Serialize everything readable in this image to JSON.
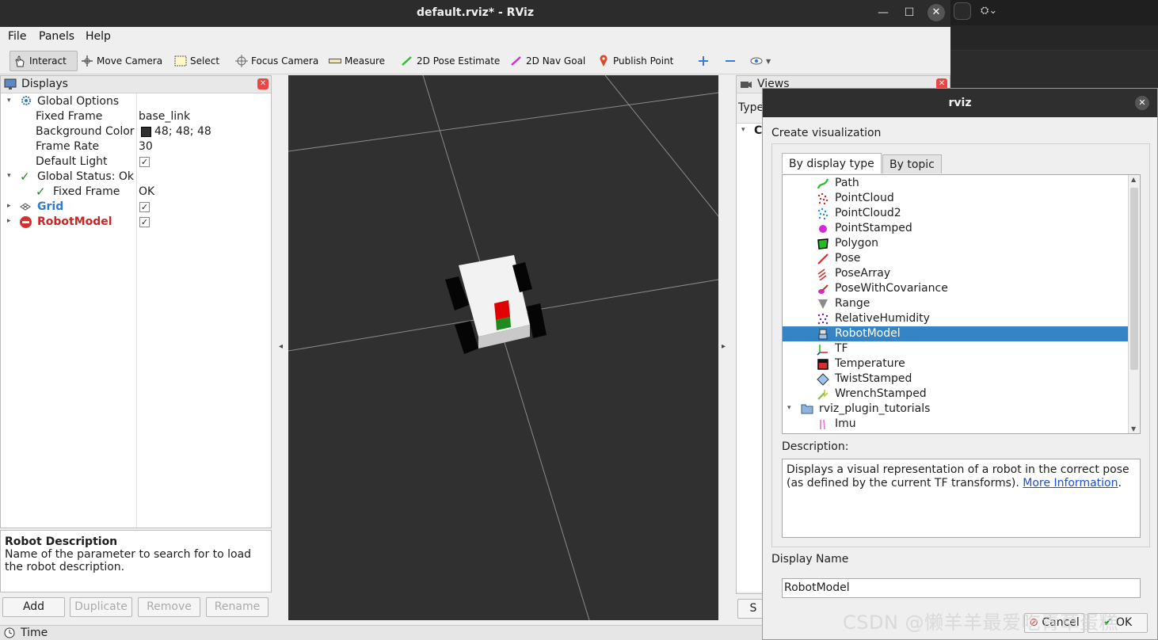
{
  "window": {
    "title": "default.rviz* - RViz",
    "minimize": "—",
    "maximize": "☐",
    "close": "✕"
  },
  "menu": {
    "file": "File",
    "panels": "Panels",
    "help": "Help"
  },
  "toolbar": {
    "interact": "Interact",
    "move_camera": "Move Camera",
    "select": "Select",
    "focus_camera": "Focus Camera",
    "measure": "Measure",
    "pose_estimate": "2D Pose Estimate",
    "nav_goal": "2D Nav Goal",
    "publish_point": "Publish Point"
  },
  "displays": {
    "title": "Displays",
    "rows": [
      {
        "label": "Global Options",
        "value": ""
      },
      {
        "label": "Fixed Frame",
        "value": "base_link"
      },
      {
        "label": "Background Color",
        "value": "48; 48; 48"
      },
      {
        "label": "Frame Rate",
        "value": "30"
      },
      {
        "label": "Default Light",
        "value": "✓"
      },
      {
        "label": "Global Status: Ok",
        "value": ""
      },
      {
        "label": "Fixed Frame",
        "value": "OK"
      },
      {
        "label": "Grid",
        "value": "✓"
      },
      {
        "label": "RobotModel",
        "value": "✓"
      }
    ],
    "colors": {
      "grid": "#2e7bcf",
      "robotmodel": "#c62828",
      "bg_swatch": "#303030"
    }
  },
  "description_panel": {
    "heading": "Robot Description",
    "text": "Name of the parameter to search for to load the robot description."
  },
  "buttons": {
    "add": "Add",
    "duplicate": "Duplicate",
    "remove": "Remove",
    "rename": "Rename"
  },
  "time": {
    "label": "Time"
  },
  "views": {
    "title": "Views",
    "type_label": "Type",
    "col_letter": "C",
    "save_letter": "S"
  },
  "dialog": {
    "title": "rviz",
    "heading": "Create visualization",
    "tabs": [
      "By display type",
      "By topic"
    ],
    "items": [
      {
        "label": "Path",
        "icon": "path-icon"
      },
      {
        "label": "PointCloud",
        "icon": "pointcloud-icon"
      },
      {
        "label": "PointCloud2",
        "icon": "pointcloud2-icon"
      },
      {
        "label": "PointStamped",
        "icon": "pointstamped-icon"
      },
      {
        "label": "Polygon",
        "icon": "polygon-icon"
      },
      {
        "label": "Pose",
        "icon": "pose-icon"
      },
      {
        "label": "PoseArray",
        "icon": "posearray-icon"
      },
      {
        "label": "PoseWithCovariance",
        "icon": "posewithcovariance-icon"
      },
      {
        "label": "Range",
        "icon": "range-icon"
      },
      {
        "label": "RelativeHumidity",
        "icon": "relativehumidity-icon"
      },
      {
        "label": "RobotModel",
        "icon": "robotmodel-icon",
        "selected": true
      },
      {
        "label": "TF",
        "icon": "tf-icon"
      },
      {
        "label": "Temperature",
        "icon": "temperature-icon"
      },
      {
        "label": "TwistStamped",
        "icon": "twiststamped-icon"
      },
      {
        "label": "WrenchStamped",
        "icon": "wrenchstamped-icon"
      },
      {
        "label": "rviz_plugin_tutorials",
        "icon": "folder-icon"
      },
      {
        "label": "Imu",
        "icon": "imu-icon"
      }
    ],
    "description_label": "Description:",
    "description_text": "Displays a visual representation of a robot in the correct pose (as defined by the current TF transforms).",
    "description_link": "More Information",
    "display_name_label": "Display Name",
    "display_name_value": "RobotModel",
    "cancel": "Cancel",
    "ok": "OK",
    "selection_color": "#3584c6"
  },
  "watermark": "CSDN @懒羊羊最爱吃青草蛋糕"
}
